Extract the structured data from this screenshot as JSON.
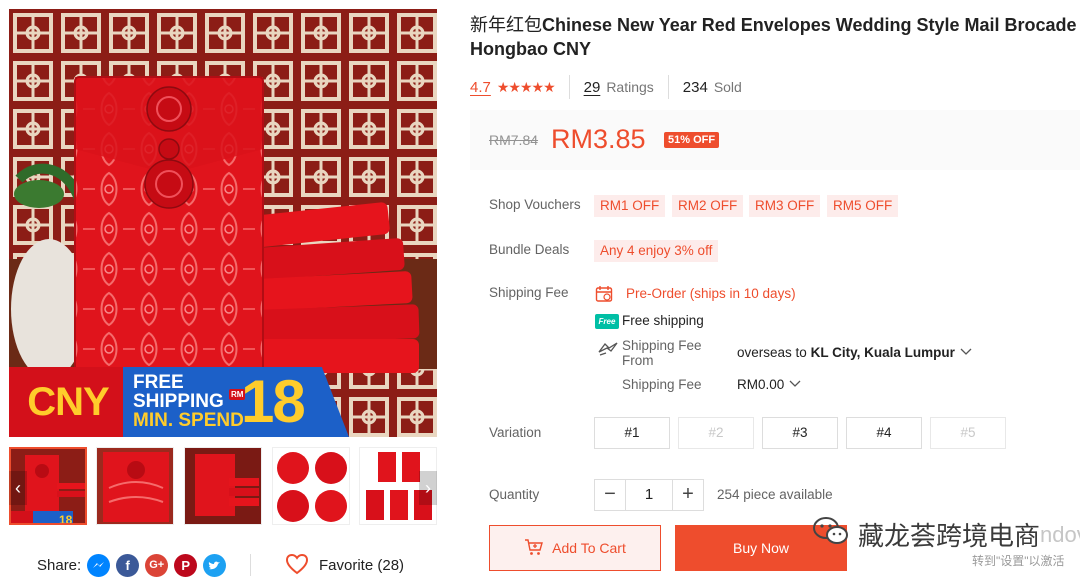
{
  "product": {
    "title_cn": "新年红包",
    "title_en": "Chinese New Year Red Envelopes Wedding Style Mail Brocade Hongbao CNY",
    "rating": "4.7",
    "stars": "★★★★★",
    "ratings_count": "29",
    "ratings_label": "Ratings",
    "sold_count": "234",
    "sold_label": "Sold",
    "old_price": "RM7.84",
    "price": "RM3.85",
    "discount_badge": "51% OFF"
  },
  "banner": {
    "cny": "CNY",
    "free": "FREE",
    "shipping": "SHIPPING",
    "min_spend": "MIN. SPEND",
    "rm": "RM",
    "amount": "18"
  },
  "gallery": {
    "prev_arrow": "‹",
    "next_arrow": "›"
  },
  "share": {
    "label": "Share:",
    "favorite_label": "Favorite (28)"
  },
  "vouchers": {
    "label": "Shop Vouchers",
    "items": [
      "RM1 OFF",
      "RM2 OFF",
      "RM3 OFF",
      "RM5 OFF"
    ]
  },
  "bundle": {
    "label": "Bundle Deals",
    "text": "Any 4 enjoy 3% off"
  },
  "shipping": {
    "label": "Shipping Fee",
    "preorder": "Pre-Order (ships in 10 days)",
    "free_badge": "Free",
    "free_shipping": "Free shipping",
    "fee_from_label": "Shipping Fee From",
    "from": "overseas",
    "to_word": "to",
    "destination": "KL City, Kuala Lumpur",
    "fee_label": "Shipping Fee",
    "fee_value": "RM0.00"
  },
  "variation": {
    "label": "Variation",
    "options": [
      "#1",
      "#2",
      "#3",
      "#4",
      "#5"
    ]
  },
  "quantity": {
    "label": "Quantity",
    "minus": "−",
    "value": "1",
    "plus": "+",
    "available": "254 piece available"
  },
  "actions": {
    "add_to_cart": "Add To Cart",
    "buy_now": "Buy Now"
  },
  "watermark": {
    "main": "藏龙荟跨境电商",
    "partial": "ndov",
    "sub": "转到\"设置\"以激活"
  },
  "colors": {
    "accent": "#ee4d2d",
    "banner_red": "#d3101a",
    "banner_blue": "#1c60c8",
    "banner_yellow": "#ffcc2b"
  }
}
